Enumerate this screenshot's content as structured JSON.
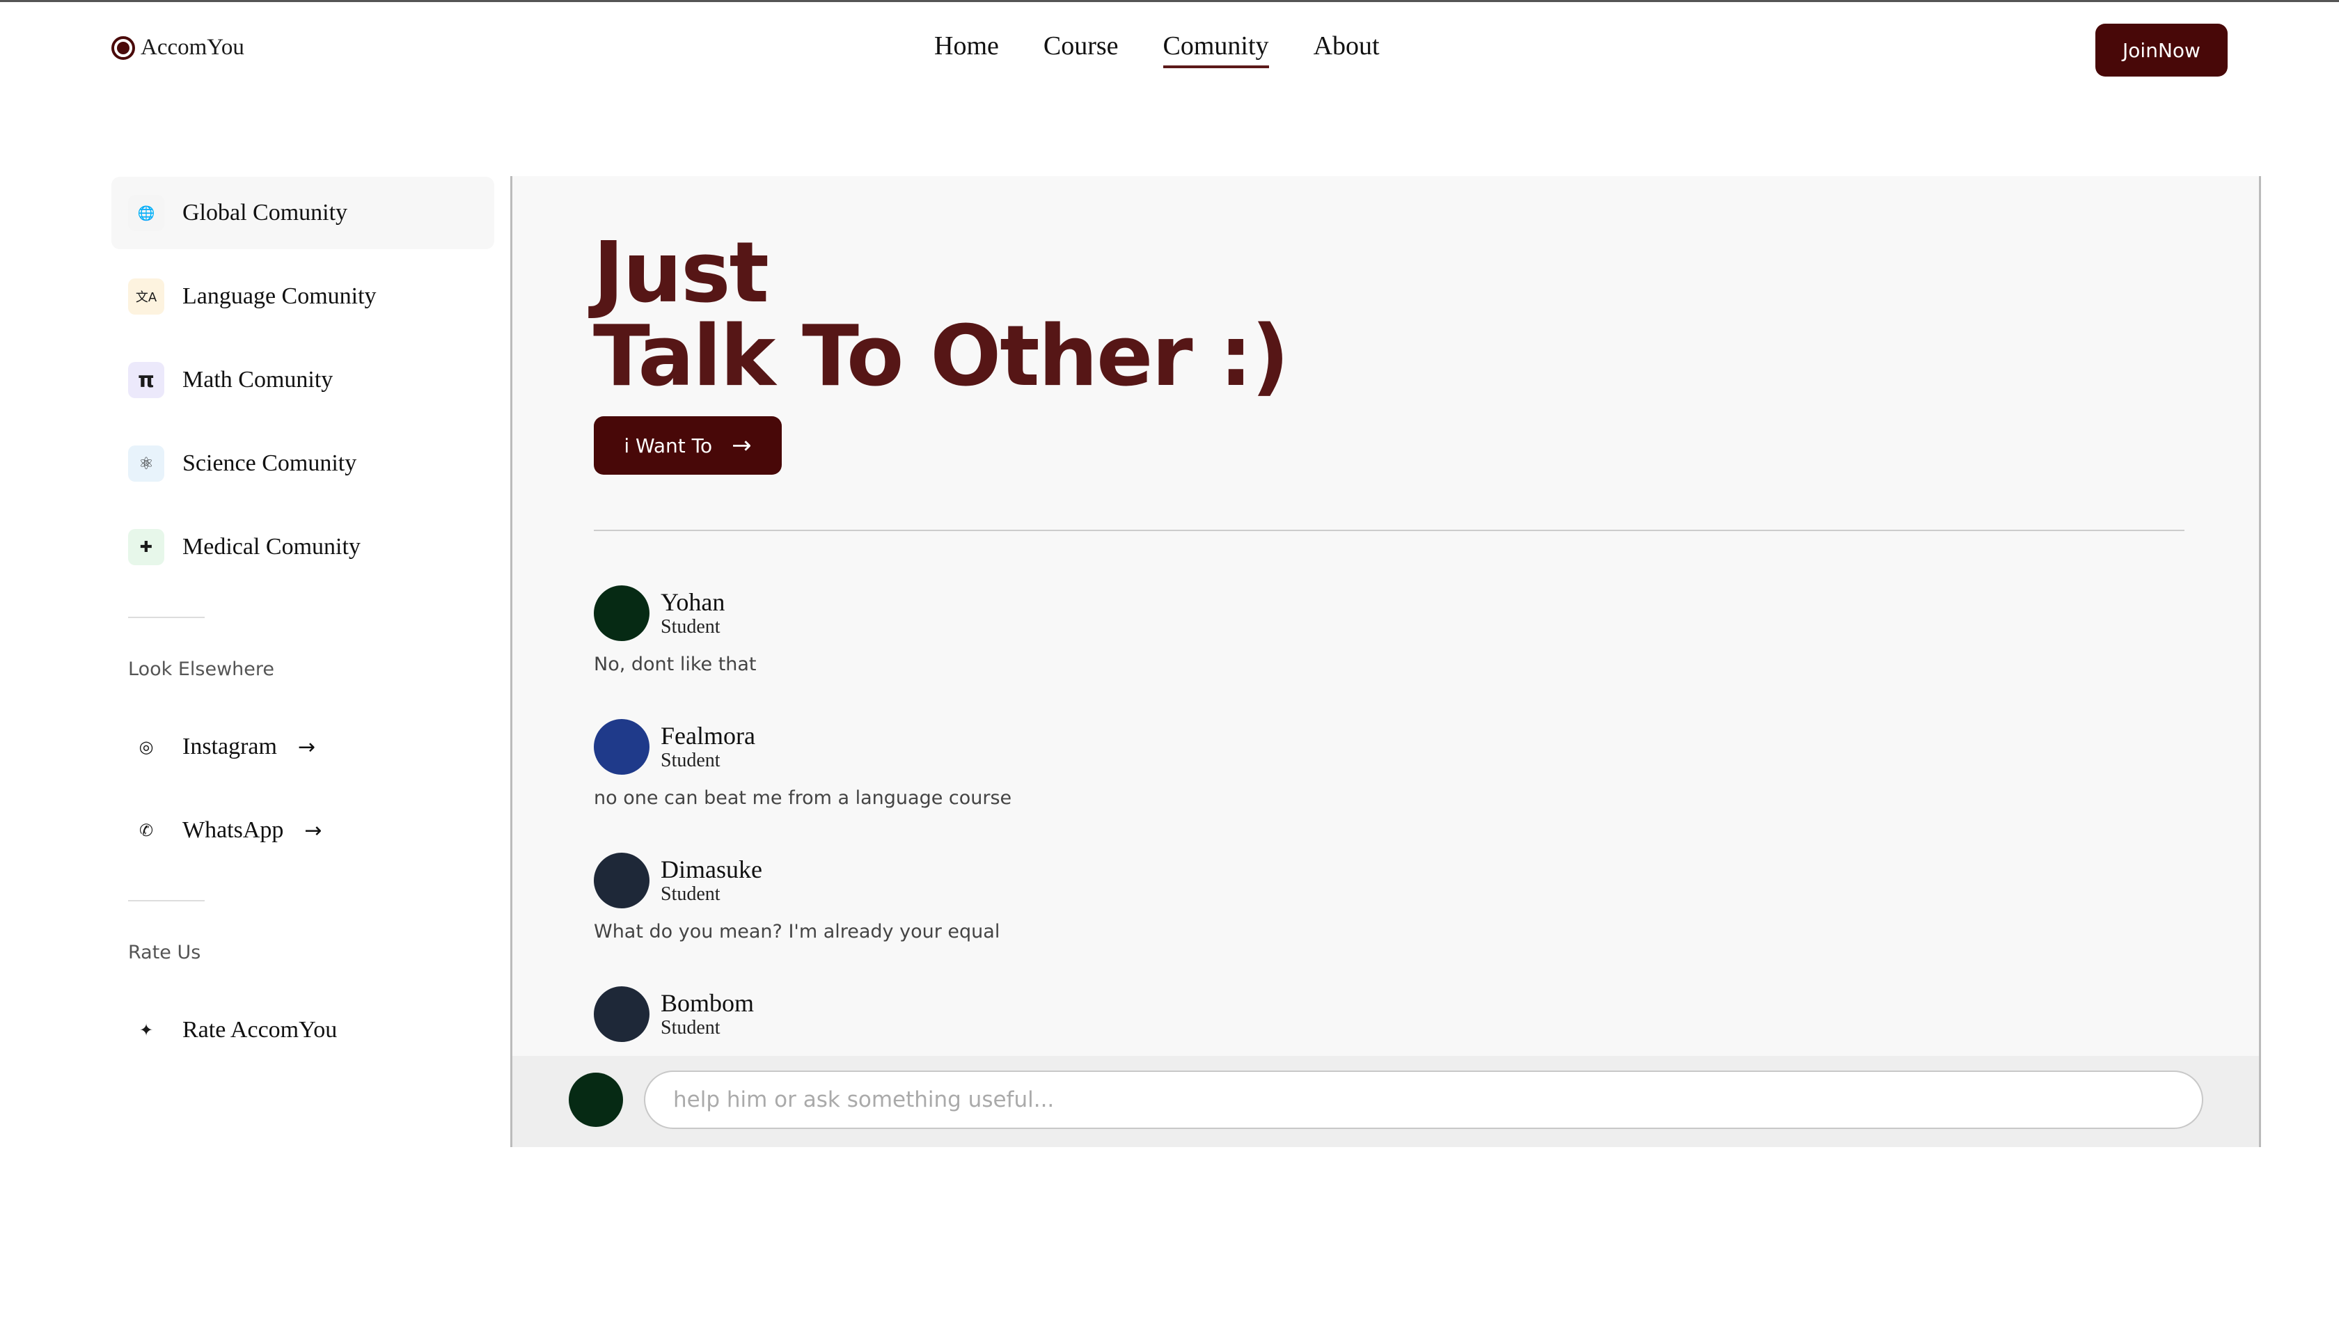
{
  "header": {
    "logo_text": "AccomYou",
    "nav": [
      {
        "label": "Home",
        "active": false
      },
      {
        "label": "Course",
        "active": false
      },
      {
        "label": "Comunity",
        "active": true
      },
      {
        "label": "About",
        "active": false
      }
    ],
    "join_label": "JoinNow"
  },
  "sidebar": {
    "communities": [
      {
        "label": "Global Comunity",
        "icon": "globe-icon",
        "glyph": "🌐",
        "color": "#f5f5f5",
        "active": true
      },
      {
        "label": "Language Comunity",
        "icon": "translate-icon",
        "glyph": "文A",
        "color": "#fdf3df",
        "active": false
      },
      {
        "label": "Math Comunity",
        "icon": "pi-icon",
        "glyph": "π",
        "color": "#ece9fb",
        "active": false
      },
      {
        "label": "Science Comunity",
        "icon": "atom-icon",
        "glyph": "⚛",
        "color": "#e8f3fb",
        "active": false
      },
      {
        "label": "Medical Comunity",
        "icon": "medical-icon",
        "glyph": "✚",
        "color": "#e7f7ea",
        "active": false
      }
    ],
    "elsewhere_heading": "Look Elsewhere",
    "links": [
      {
        "label": "Instagram",
        "icon": "instagram-icon",
        "glyph": "◎"
      },
      {
        "label": "WhatsApp",
        "icon": "whatsapp-icon",
        "glyph": "✆"
      }
    ],
    "rate_heading": "Rate Us",
    "rate": {
      "label": "Rate AccomYou",
      "icon": "sparkle-icon",
      "glyph": "✦"
    }
  },
  "main": {
    "hero_line1": "Just",
    "hero_line2": "Talk To Other :)",
    "cta_label": "i Want To",
    "comments": [
      {
        "name": "Yohan",
        "role": "Student",
        "text": "No, dont like that",
        "avatar_color": "#062a14"
      },
      {
        "name": "Fealmora",
        "role": "Student",
        "text": "no one can beat me from a language course",
        "avatar_color": "#1f3a8a"
      },
      {
        "name": "Dimasuke",
        "role": "Student",
        "text": "What do you mean? I'm already your equal",
        "avatar_color": "#1e2838"
      },
      {
        "name": "Bombom",
        "role": "Student",
        "text": "",
        "avatar_color": "#1e2838"
      }
    ],
    "reply_placeholder": "help him or ask something useful..."
  }
}
